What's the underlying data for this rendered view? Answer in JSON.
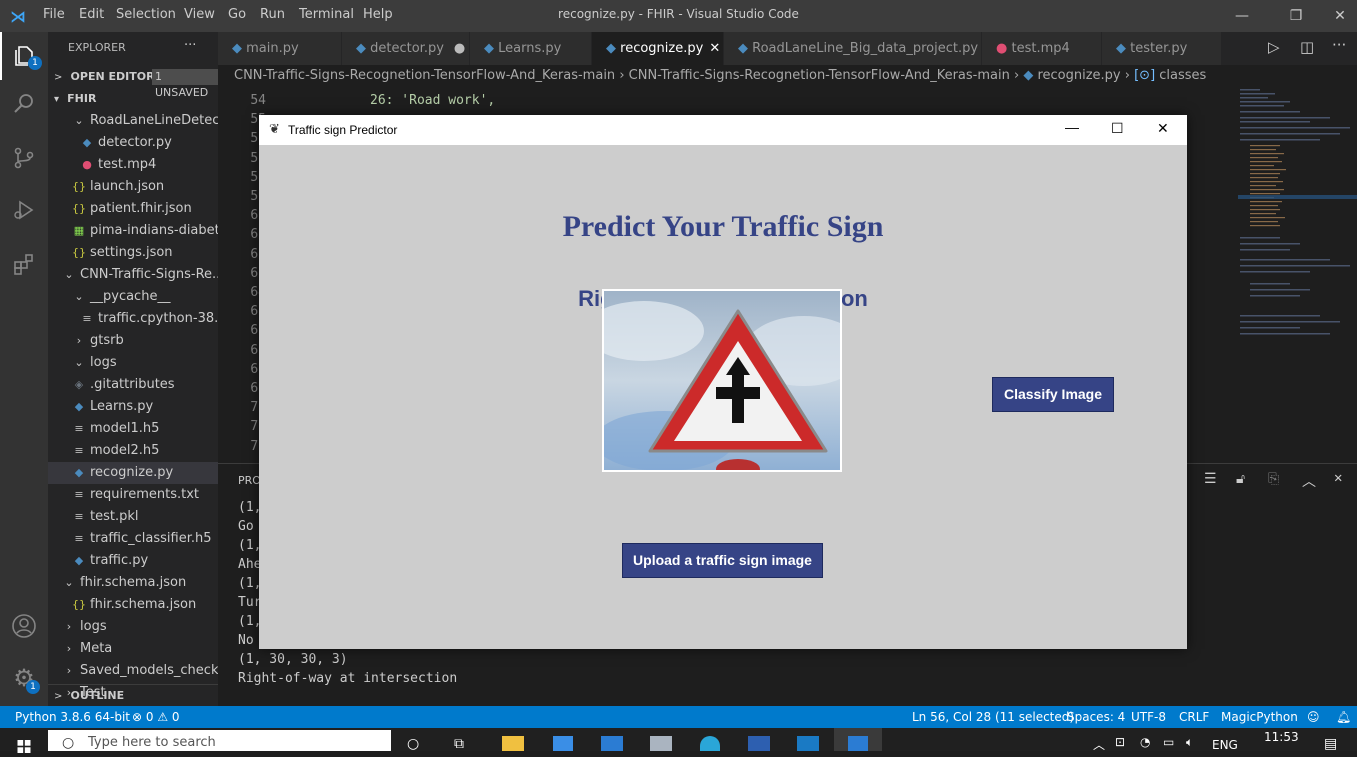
{
  "titlebar": {
    "menu": [
      "File",
      "Edit",
      "Selection",
      "View",
      "Go",
      "Run",
      "Terminal",
      "Help"
    ],
    "title": "recognize.py - FHIR - Visual Studio Code"
  },
  "activity": {
    "explorer_badge": "1",
    "manage_badge": "1"
  },
  "sidebar": {
    "header": "EXPLORER",
    "more": "···",
    "open_editors": "OPEN EDITORS",
    "unsaved": "1 UNSAVED",
    "root": "FHIR",
    "items": [
      {
        "label": "RoadLaneLineDetect...",
        "icon": "▾"
      },
      {
        "label": "detector.py",
        "icon": "py"
      },
      {
        "label": "test.mp4",
        "icon": "mp4"
      },
      {
        "label": "launch.json",
        "icon": "{}"
      },
      {
        "label": "patient.fhir.json",
        "icon": "{}"
      },
      {
        "label": "pima-indians-diabet...",
        "icon": "csv"
      },
      {
        "label": "settings.json",
        "icon": "{}"
      },
      {
        "label": "CNN-Traffic-Signs-Re...",
        "icon": "▾"
      },
      {
        "label": "__pycache__",
        "icon": "▾"
      },
      {
        "label": "traffic.cpython-38....",
        "icon": "≡"
      },
      {
        "label": "gtsrb",
        "icon": ">"
      },
      {
        "label": "logs",
        "icon": "▾"
      },
      {
        "label": ".gitattributes",
        "icon": "git"
      },
      {
        "label": "Learns.py",
        "icon": "py"
      },
      {
        "label": "model1.h5",
        "icon": "≡"
      },
      {
        "label": "model2.h5",
        "icon": "≡"
      },
      {
        "label": "recognize.py",
        "icon": "py"
      },
      {
        "label": "requirements.txt",
        "icon": "≡"
      },
      {
        "label": "test.pkl",
        "icon": "≡"
      },
      {
        "label": "traffic_classifier.h5",
        "icon": "≡"
      },
      {
        "label": "traffic.py",
        "icon": "py"
      },
      {
        "label": "fhir.schema.json",
        "icon": "▾"
      },
      {
        "label": "fhir.schema.json",
        "icon": "{}"
      },
      {
        "label": "logs",
        "icon": ">"
      },
      {
        "label": "Meta",
        "icon": ">"
      },
      {
        "label": "Saved_models_check...",
        "icon": ">"
      },
      {
        "label": "Test",
        "icon": ">"
      }
    ],
    "outline": "OUTLINE"
  },
  "tabs": [
    {
      "label": "main.py"
    },
    {
      "label": "detector.py"
    },
    {
      "label": "Learns.py"
    },
    {
      "label": "recognize.py",
      "close": "✕"
    },
    {
      "label": "RoadLaneLine_Big_data_project.py"
    },
    {
      "label": "test.mp4"
    },
    {
      "label": "tester.py"
    }
  ],
  "breadcrumb": {
    "parts": [
      "CNN-Traffic-Signs-Recognetion-TensorFlow-And_Keras-main",
      "CNN-Traffic-Signs-Recognetion-TensorFlow-And_Keras-main",
      "recognize.py",
      "classes"
    ]
  },
  "editor": {
    "lines": [
      "54",
      "55",
      "56",
      "57",
      "58",
      "59",
      "60",
      "61",
      "62",
      "63",
      "64",
      "65",
      "66",
      "67",
      "68",
      "69",
      "70",
      "71",
      "72"
    ],
    "code_line": "26: 'Road work',"
  },
  "terminal": {
    "lines": [
      "(1,",
      "Go",
      "(1,",
      "Ahe",
      "(1,",
      "Tur",
      "(1,",
      "No",
      "(1, 30, 30, 3)",
      "Right-of-way at intersection"
    ],
    "pro_label": "PRO"
  },
  "statusbar": {
    "python": "Python 3.8.6 64-bit",
    "errors": "⊗ 0 ⚠ 0",
    "position": "Ln 56, Col 28 (11 selected)",
    "spaces": "Spaces: 4",
    "encoding": "UTF-8",
    "eol": "CRLF",
    "language": "MagicPython"
  },
  "taskbar": {
    "search_placeholder": "Type here to search",
    "lang": "ENG",
    "time": "11:53"
  },
  "tk": {
    "title": "Traffic sign Predictor",
    "heading": "Predict Your Traffic Sign",
    "result": "Right-of-way at intersection",
    "classify_label": "Classify Image",
    "upload_label": "Upload a traffic sign image"
  },
  "colors": {
    "accent": "#364486",
    "statusbar": "#007acc",
    "tk_bg": "#cdcdcd",
    "sign_red": "#cc2a2a"
  }
}
